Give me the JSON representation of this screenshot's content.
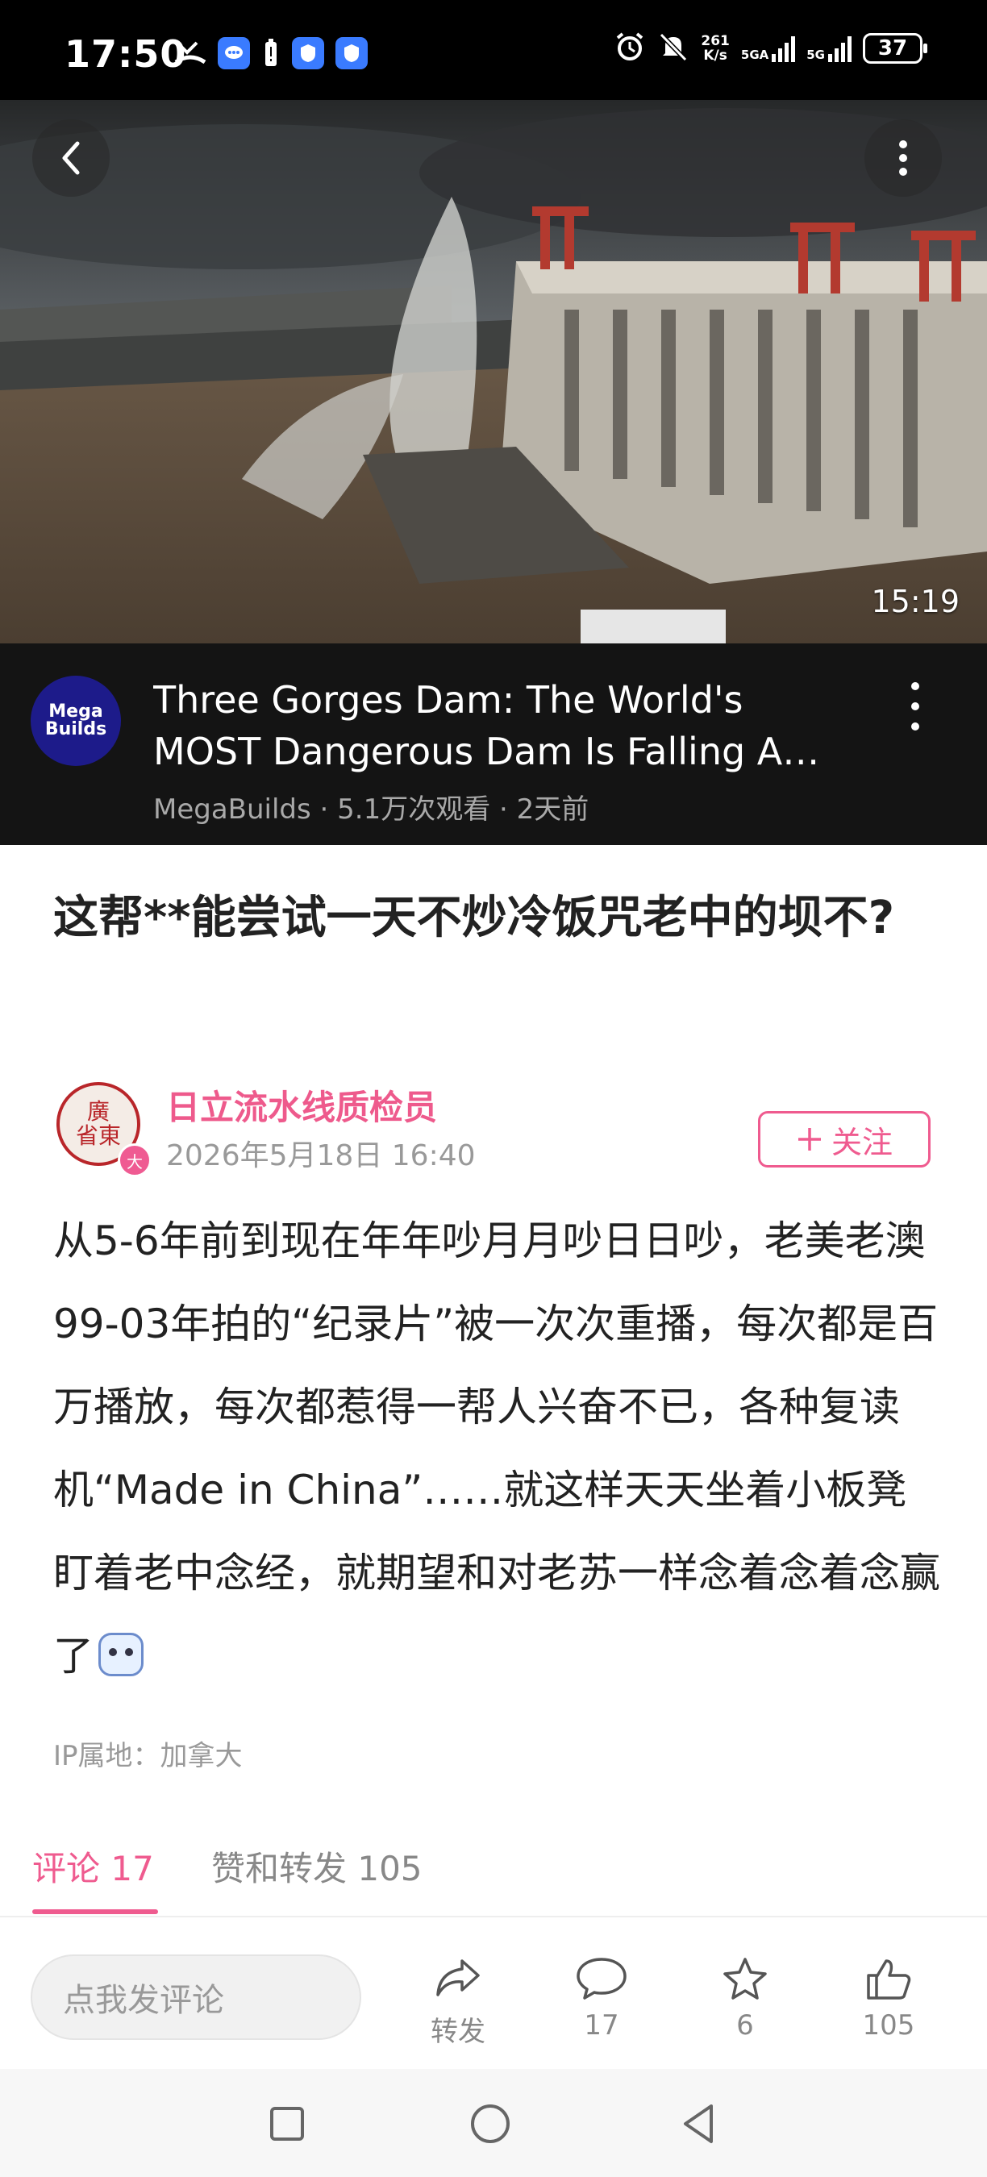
{
  "status_bar": {
    "time": "17:50",
    "net_speed_top": "261",
    "net_speed_bottom": "K/s",
    "signal1_label": "5GA",
    "signal2_label": "5G",
    "battery": "37",
    "icons": [
      "missed-call-icon",
      "message-icon",
      "battery-alert-icon",
      "app-icon",
      "app-icon",
      "alarm-icon",
      "mute-icon",
      "signal-icon",
      "signal-icon",
      "battery-icon"
    ]
  },
  "video": {
    "duration": "15:19",
    "title_line1": "Three Gorges Dam: The World's",
    "title_line2": "MOST Dangerous Dam Is Falling A…",
    "channel_logo_text1": "Mega",
    "channel_logo_text2": "Builds",
    "meta": "MegaBuilds · 5.1万次观看 · 2天前"
  },
  "post": {
    "title": "这帮**能尝试一天不炒冷饭咒老中的坝不?",
    "author": "日立流水线质检员",
    "date": "2026年5月18日 16:40",
    "avatar_text1": "廣",
    "avatar_text2": "省東",
    "avatar_badge": "大",
    "follow_label": "关注",
    "body": "从5-6年前到现在年年吵月月吵日日吵，老美老澳99-03年拍的“纪录片”被一次次重播，每次都是百万播放，每次都惹得一帮人兴奋不已，各种复读机“Made in China”……就这样天天坐着小板凳盯着老中念经，就期望和对老苏一样念着念着念赢了",
    "ip": "IP属地：加拿大"
  },
  "tabs": {
    "comments": "评论 17",
    "likes_reposts": "赞和转发 105"
  },
  "actions": {
    "comment_placeholder": "点我发评论",
    "repost": "转发",
    "comments": "17",
    "favorites": "6",
    "likes": "105"
  },
  "colors": {
    "accent": "#ef5b8f",
    "video_bar": "#141414"
  }
}
